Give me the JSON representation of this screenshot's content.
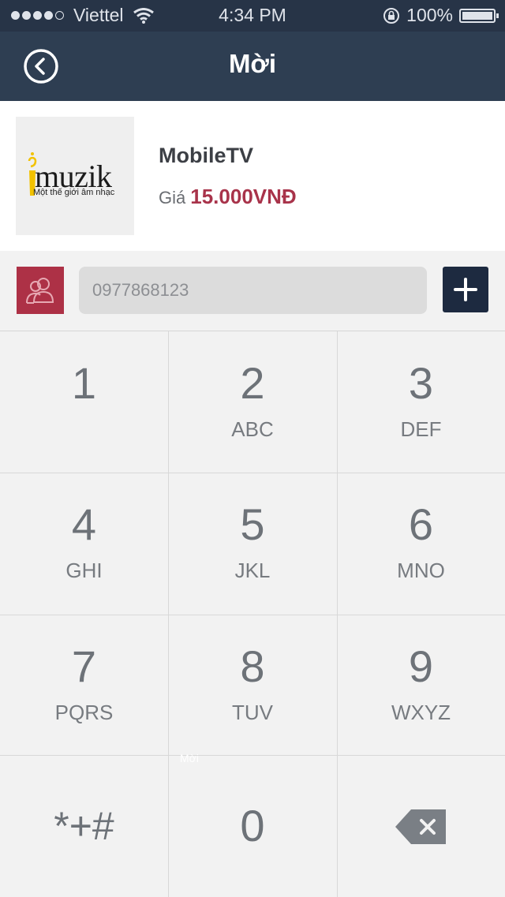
{
  "status_bar": {
    "carrier": "Viettel",
    "time": "4:34 PM",
    "battery": "100%"
  },
  "header": {
    "title": "Mời",
    "back_icon": "back-circle-icon"
  },
  "product": {
    "logo_word": "muzik",
    "logo_tagline": "Một thế giới âm nhạc",
    "name": "MobileTV",
    "price_label": "Giá",
    "price_value": "15.000VNĐ"
  },
  "phone_input": {
    "value": "0977868123"
  },
  "keypad": {
    "keys": [
      {
        "number": "1",
        "letters": ""
      },
      {
        "number": "2",
        "letters": "ABC"
      },
      {
        "number": "3",
        "letters": "DEF"
      },
      {
        "number": "4",
        "letters": "GHI"
      },
      {
        "number": "5",
        "letters": "JKL"
      },
      {
        "number": "6",
        "letters": "MNO"
      },
      {
        "number": "7",
        "letters": "PQRS"
      },
      {
        "number": "8",
        "letters": "TUV"
      },
      {
        "number": "9",
        "letters": "WXYZ"
      },
      {
        "number": "*+#",
        "letters": ""
      },
      {
        "number": "0",
        "letters": ""
      }
    ]
  },
  "overlay_text": "Mời",
  "colors": {
    "status_bar_bg": "#273447",
    "nav_bg": "#2e3e52",
    "accent_red": "#a8334a",
    "contacts_btn": "#ad3146",
    "add_btn": "#1d2a40",
    "logo_gold": "#f2c200"
  }
}
